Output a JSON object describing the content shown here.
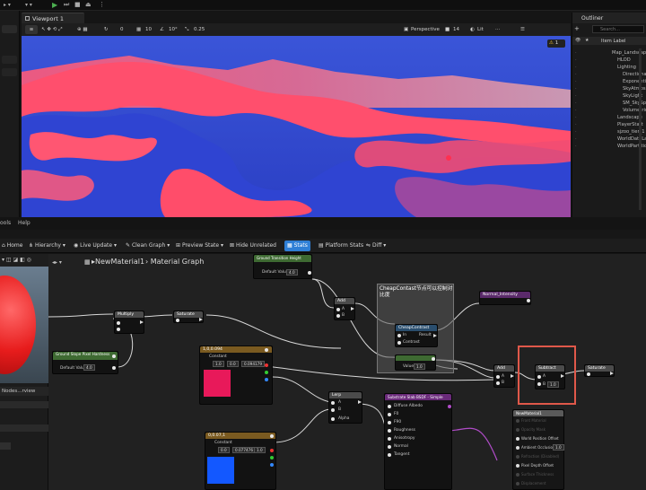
{
  "viewport": {
    "tab_label": "Viewport 1",
    "perspective": "Perspective",
    "lit": "Lit",
    "grid_snap": "10",
    "rot_snap": "10°",
    "scale_snap": "0.25",
    "cam_speed": "14",
    "rot_value": "0",
    "warning_count": "1"
  },
  "outliner": {
    "title": "Outliner",
    "search_placeholder": "Search...",
    "col_label": "Item Label",
    "items": [
      "Map_Landscape",
      "HLOD",
      "Lighting",
      "DirectionalLight",
      "ExponentialHeightFog",
      "SkyAtmosphere",
      "SkyLight",
      "SM_SkySphere",
      "VolumetricCloud",
      "Landscape",
      "PlayerStart",
      "sjzoo_tier_1",
      "WorldDataLayers",
      "WorldPartition"
    ]
  },
  "menu": {
    "tools": "ools",
    "help": "Help"
  },
  "toolbar2": {
    "home": "Home",
    "hierarchy": "Hierarchy",
    "live_update": "Live Update",
    "clean_graph": "Clean Graph",
    "preview_state": "Preview State",
    "hide_unrelated": "Hide Unrelated",
    "stats": "Stats",
    "platform_stats": "Platform Stats",
    "diff": "Diff"
  },
  "breadcrumb": {
    "material": "NewMaterial1",
    "graph": "Material Graph"
  },
  "left_panel": {
    "nodes_label": "Nodes...rview"
  },
  "nodes": {
    "multiply": "Multiply",
    "saturate1": "Saturate",
    "saturate2": "Saturate",
    "add1": "Add",
    "add2": "Add",
    "subtract": "Subtract",
    "lerp": "Lerp",
    "ground_slope": "Ground Slope Pixel Hardness",
    "ground_slope_sub": "Parameter",
    "default_value_label": "Default Value",
    "default_value": "4.0",
    "top_param": "Ground Transition Height",
    "top_default": "4.0",
    "constant1_title": "1,0,0.094",
    "constant_label": "Constant",
    "constant1": [
      "1.0",
      "0.0",
      "0.094179"
    ],
    "constant2_title": "0,0.07,1",
    "constant2": [
      "0.0",
      "0.077476",
      "1.0"
    ],
    "normal_param": "Normal_Intensity",
    "cheap_contrast_note": "CheapContast节点可以控制对比度",
    "cheap_contrast": "CheapContrast",
    "cheap_in": "In",
    "cheap_contrast_pin": "Contrast",
    "cheap_result": "Result",
    "value_label": "Value",
    "value": "1.0",
    "b_label": "B",
    "b_value": "1.0",
    "a_label": "A",
    "alpha_label": "Alpha",
    "substrate": "Substrate Slab BSDF - Simple",
    "sub_pins": [
      "Diffuse Albedo",
      "F0",
      "F90",
      "Roughness",
      "Anisotropy",
      "Normal",
      "Tangent"
    ],
    "new_material": "NewMaterial1",
    "mat_pins": [
      "Front Material",
      "Opacity Mask",
      "World Position Offset",
      "Ambient Occlusion",
      "Refraction (Disabled)",
      "Pixel Depth Offset",
      "Surface Thickness",
      "Displacement"
    ],
    "ao_value": "1.0"
  },
  "colors": {
    "accent_blue": "#2f7fd6",
    "highlight_red": "#e0584a",
    "const_pink": "#e8195a",
    "const_blue": "#1358ff",
    "header_green": "#3e6a32",
    "header_gray": "#4b4b4b",
    "header_purple": "#5a2a6a"
  }
}
